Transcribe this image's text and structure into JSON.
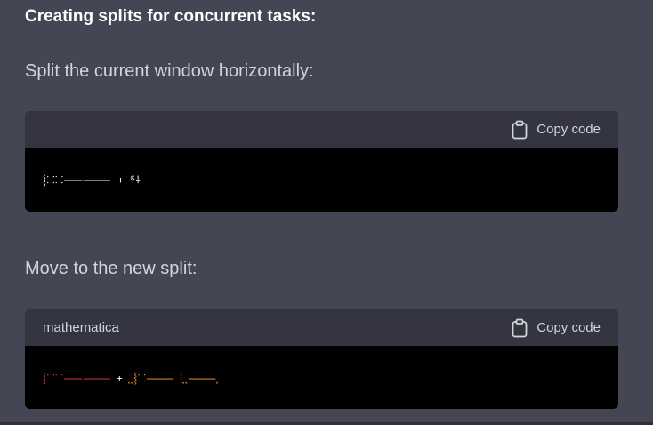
{
  "heading": "Creating splits for concurrent tasks:",
  "step1": {
    "text": "Split the current window horizontally:",
    "code_block": {
      "language": "",
      "copy_label": "Copy code",
      "copy_icon": "clipboard-icon",
      "code_tokens": [
        "⸾⸬⸬⸺⸻ + ⸹⸸"
      ]
    }
  },
  "step2": {
    "text": "Move to the new split:",
    "code_block": {
      "language": "mathematica",
      "copy_label": "Copy code",
      "copy_icon": "clipboard-icon",
      "code_tokens": [
        "⸾⸬⸬⸺⸻",
        "+",
        "⸼⸼⸾⸬⸻",
        "⸽⸼⸼⸻⸼"
      ]
    }
  },
  "colors": {
    "background": "#444654",
    "code_header": "#343541",
    "code_body": "#000000",
    "token_red": "#ef4146",
    "token_orange": "#f5a623"
  }
}
